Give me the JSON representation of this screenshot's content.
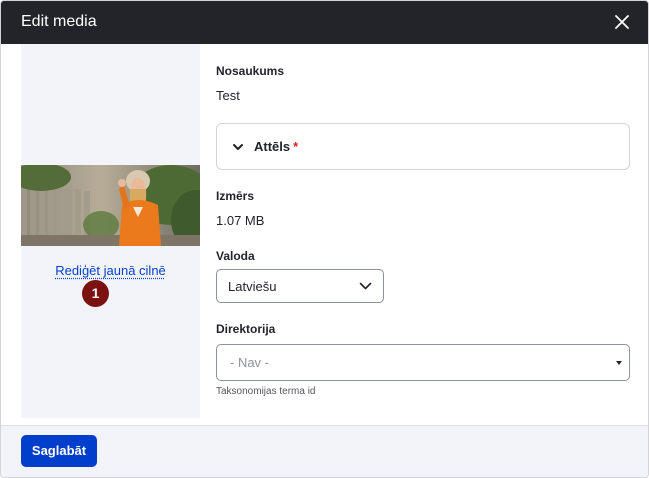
{
  "dialog": {
    "title": "Edit media"
  },
  "preview": {
    "edit_link": "Rediģēt jaunā cilnē",
    "badge": "1"
  },
  "form": {
    "name_label": "Nosaukums",
    "name_value": "Test",
    "image_section_label": "Attēls",
    "required_marker": "*",
    "size_label": "Izmērs",
    "size_value": "1.07 MB",
    "language_label": "Valoda",
    "language_value": "Latviešu",
    "directory_label": "Direktorija",
    "directory_value": "- Nav -",
    "directory_help": "Taksonomijas terma id"
  },
  "footer": {
    "save_label": "Saglabāt"
  },
  "colors": {
    "titlebar": "#232429",
    "accent": "#003ecc",
    "badge": "#7b1111",
    "required": "#dc2323"
  }
}
